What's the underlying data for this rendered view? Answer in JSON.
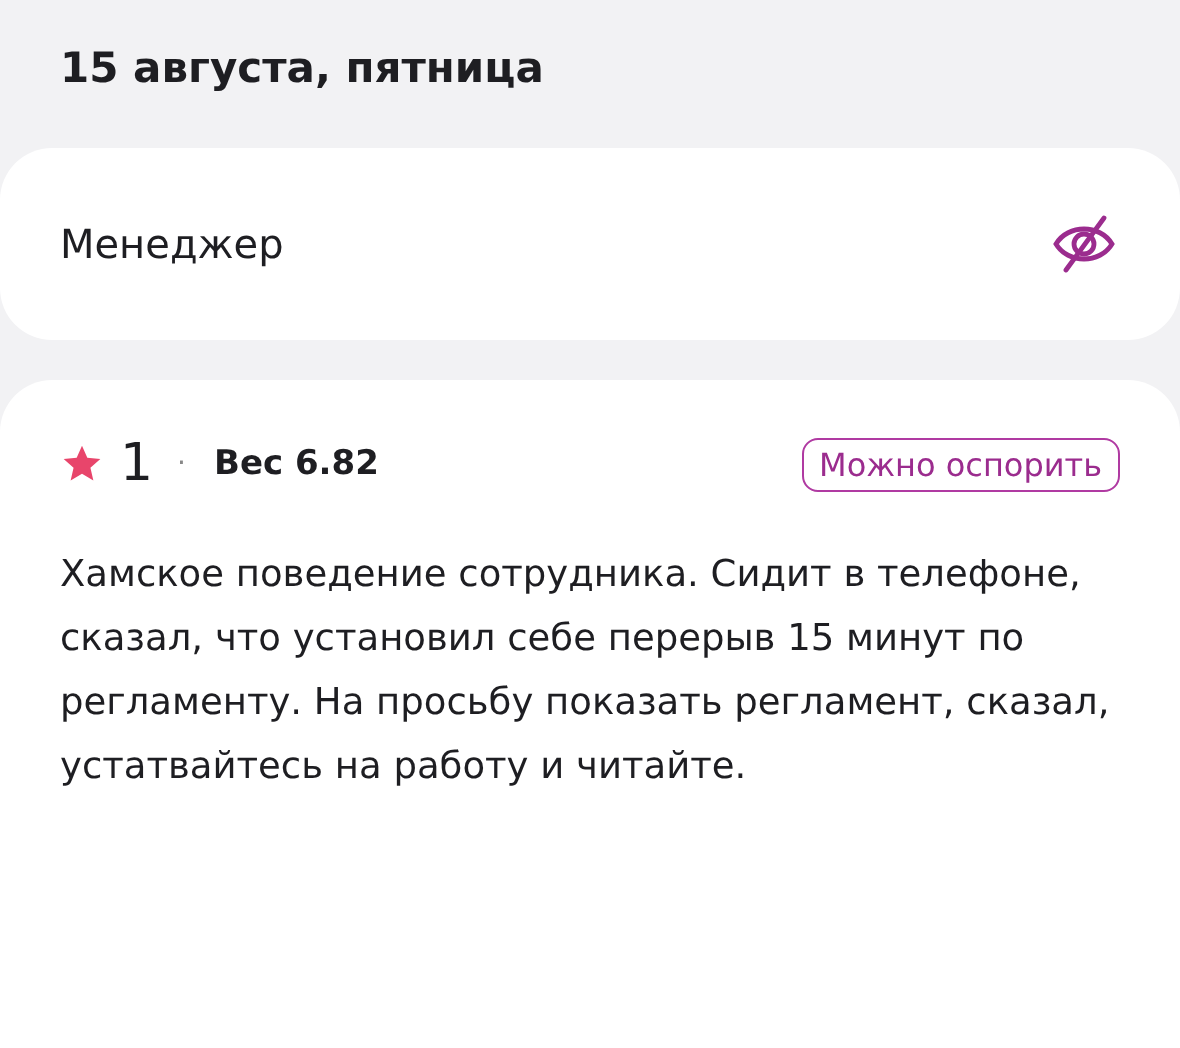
{
  "date_heading": "15 августа, пятница",
  "role_card": {
    "label": "Менеджер"
  },
  "review": {
    "rating": "1",
    "separator": "·",
    "weight": "Вес 6.82",
    "badge": "Можно оспорить",
    "text": "Хамское поведение сотрудника. Сидит в телефоне, сказал, что установил себе перерыв 15 минут по регламенту. На просьбу показать регламент, сказал, устатвайтесь на работу и читайте."
  }
}
